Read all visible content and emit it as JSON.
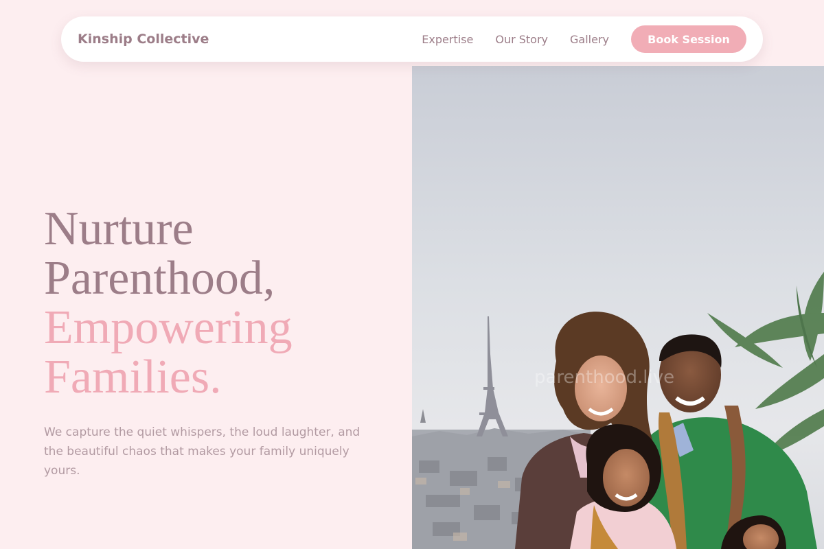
{
  "nav": {
    "brand": "Kinship Collective",
    "links": [
      "Expertise",
      "Our Story",
      "Gallery"
    ],
    "cta": "Book Session"
  },
  "hero": {
    "headline_line1": "Nurture",
    "headline_line2": "Parenthood,",
    "headline_line3": "Empowering",
    "headline_line4": "Families.",
    "subtext": "We capture the quiet whispers, the loud laughter, and the beautiful chaos that makes your family uniquely yours."
  },
  "photo": {
    "watermark": "parenthood.live",
    "description_icon": "family-photo-paris"
  },
  "colors": {
    "background": "#fdeef0",
    "brand_text": "#9c7d88",
    "accent": "#f1adb6",
    "accent_text": "#f0aab6"
  }
}
